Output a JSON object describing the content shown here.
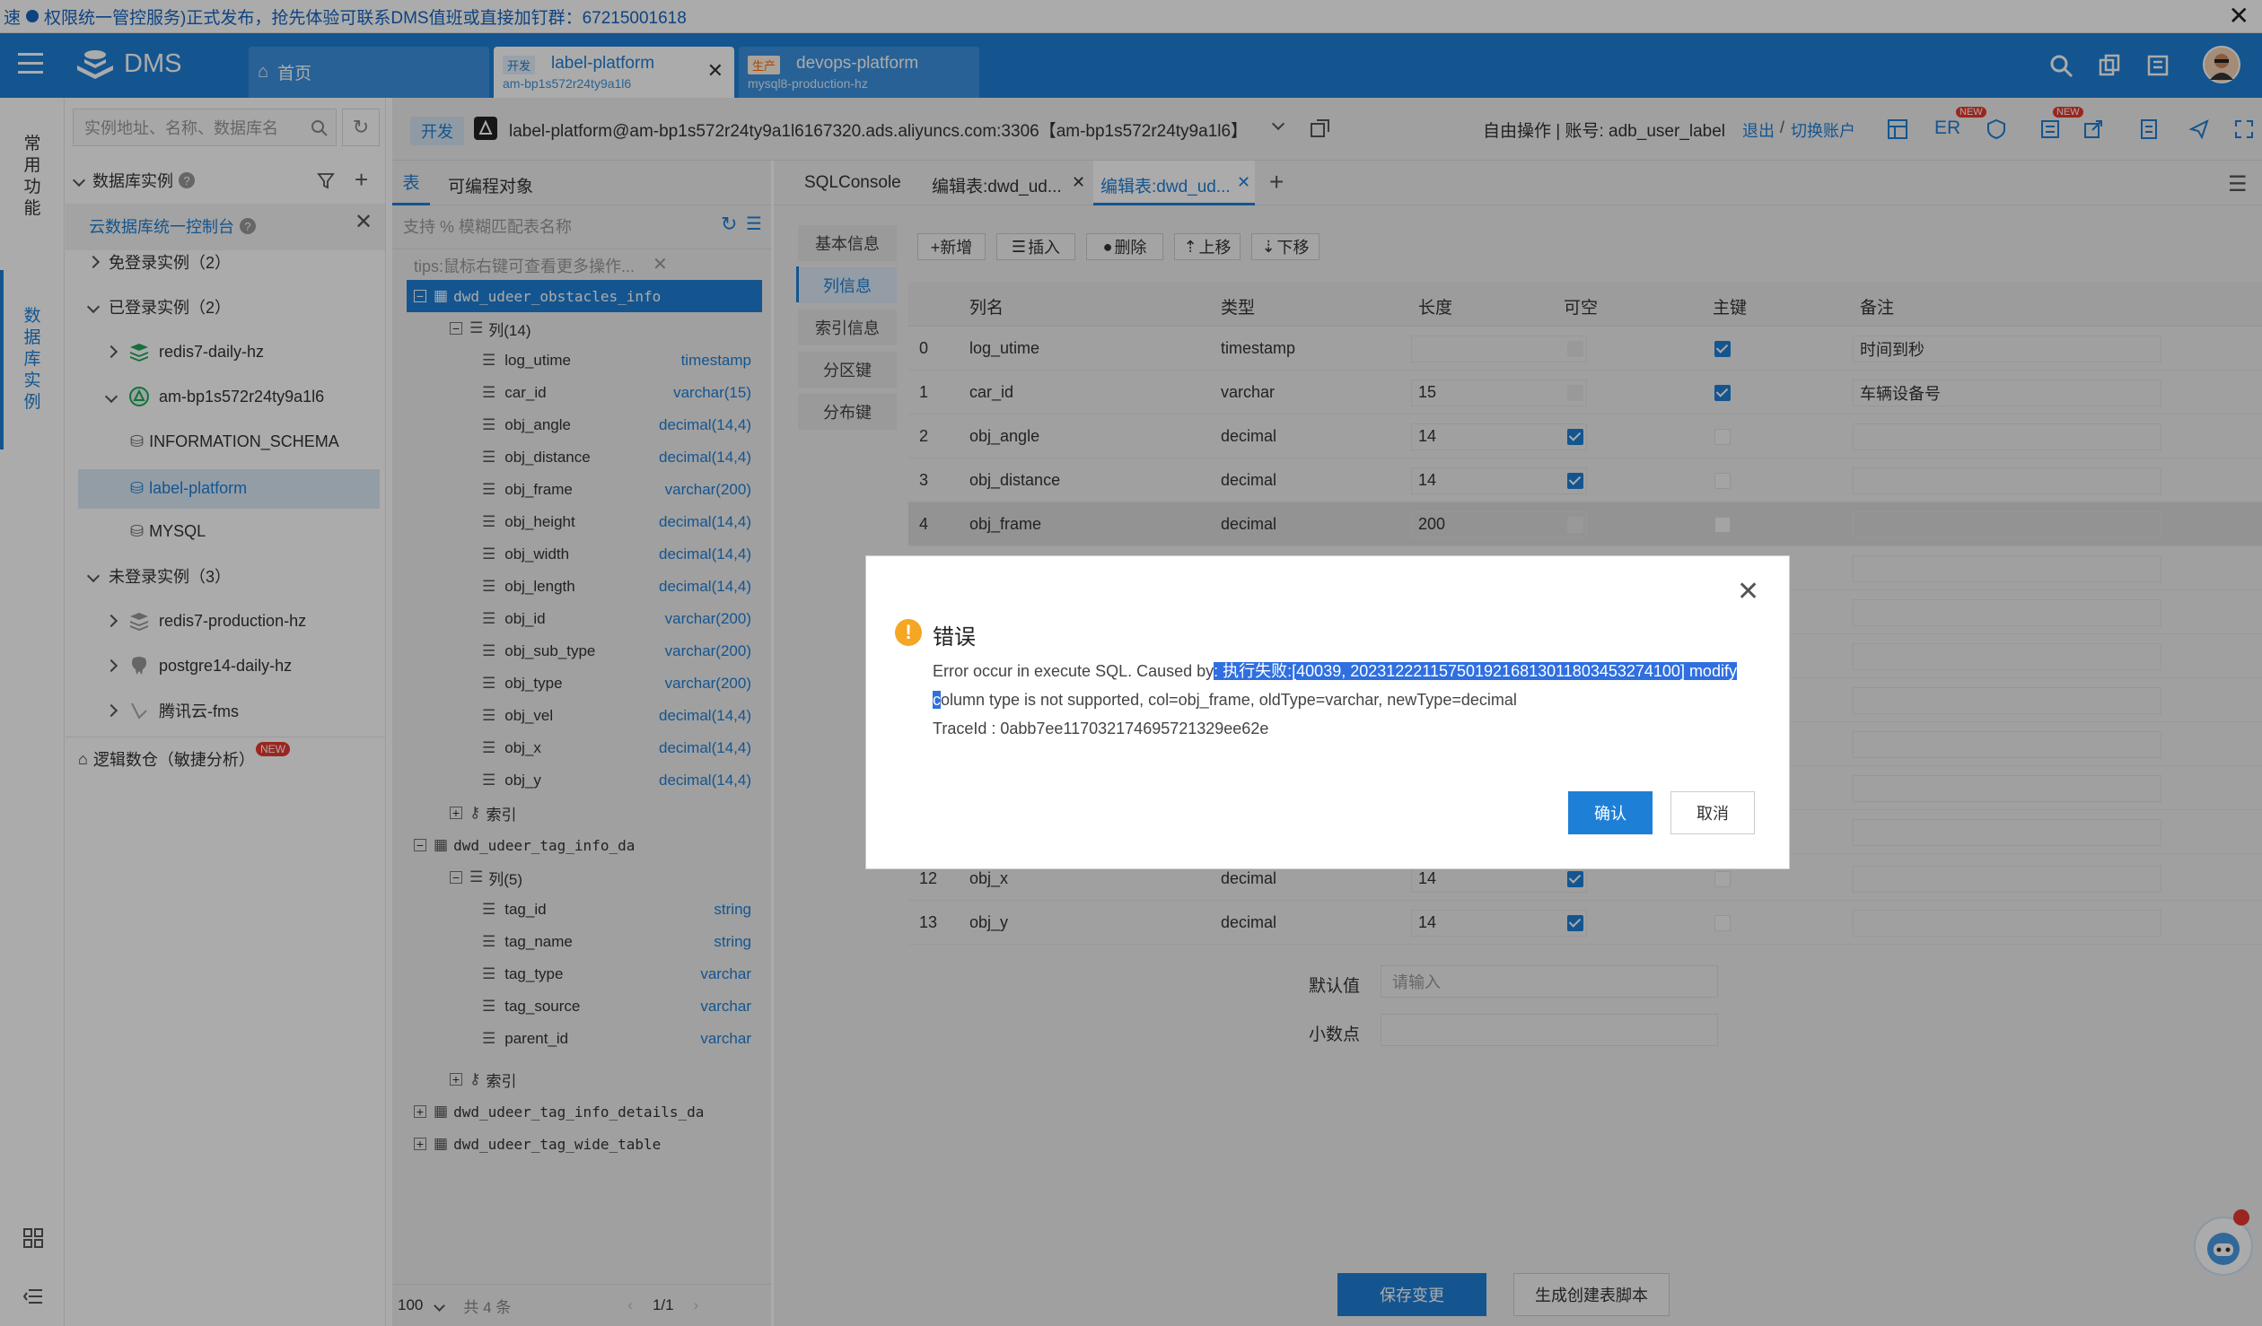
{
  "notice": {
    "text": "权限统一管控服务)正式发布，抢先体验可联系DMS值班或直接加钉群：67215001618",
    "prefix": "速"
  },
  "nav": {
    "app_name": "DMS",
    "tabs": [
      {
        "label": "首页"
      },
      {
        "env": "开发",
        "label": "label-platform",
        "sub": "am-bp1s572r24ty9a1l6",
        "env_color": "#1e7fd6"
      },
      {
        "env": "生产",
        "label": "devops-platform",
        "sub": "mysql8-production-hz",
        "env_color": "#ff6a00"
      }
    ]
  },
  "rail": {
    "common": "常用功能",
    "db_instance": "数据库实例"
  },
  "instances": {
    "search_placeholder": "实例地址、名称、数据库名",
    "header": "数据库实例",
    "console_link": "云数据库统一控制台",
    "groups": [
      {
        "label": "免登录实例（2）"
      },
      {
        "label": "已登录实例（2）"
      },
      {
        "label": "未登录实例（3）"
      }
    ],
    "logged_in": [
      {
        "label": "redis7-daily-hz"
      },
      {
        "label": "am-bp1s572r24ty9a1l6"
      }
    ],
    "databases": [
      "INFORMATION_SCHEMA",
      "label-platform",
      "MYSQL"
    ],
    "not_logged": [
      {
        "label": "redis7-production-hz"
      },
      {
        "label": "postgre14-daily-hz"
      },
      {
        "label": "腾讯云-fms"
      }
    ],
    "logic_db": "逻辑数仓（敏捷分析）",
    "new_badge": "NEW"
  },
  "connbar": {
    "env": "开发",
    "conn": "label-platform@am-bp1s572r24ty9a1l6167320.ads.aliyuncs.com:3306【am-bp1s572r24ty9a1l6】",
    "mode": "自由操作 | 账号: adb_user_label",
    "logout": "退出",
    "switch": "切换账户",
    "er": "ER",
    "new_badge": "NEW"
  },
  "objects": {
    "tab_table": "表",
    "tab_prog": "可编程对象",
    "search_placeholder": "支持 % 模糊匹配表名称",
    "tips": "tips:鼠标右键可查看更多操作...",
    "table1": "dwd_udeer_obstacles_info",
    "cols1_label": "列(14)",
    "cols1": [
      {
        "name": "log_utime",
        "type": "timestamp"
      },
      {
        "name": "car_id",
        "type": "varchar(15)"
      },
      {
        "name": "obj_angle",
        "type": "decimal(14,4)"
      },
      {
        "name": "obj_distance",
        "type": "decimal(14,4)"
      },
      {
        "name": "obj_frame",
        "type": "varchar(200)"
      },
      {
        "name": "obj_height",
        "type": "decimal(14,4)"
      },
      {
        "name": "obj_width",
        "type": "decimal(14,4)"
      },
      {
        "name": "obj_length",
        "type": "decimal(14,4)"
      },
      {
        "name": "obj_id",
        "type": "varchar(200)"
      },
      {
        "name": "obj_sub_type",
        "type": "varchar(200)"
      },
      {
        "name": "obj_type",
        "type": "varchar(200)"
      },
      {
        "name": "obj_vel",
        "type": "decimal(14,4)"
      },
      {
        "name": "obj_x",
        "type": "decimal(14,4)"
      },
      {
        "name": "obj_y",
        "type": "decimal(14,4)"
      }
    ],
    "index_label": "索引",
    "table2": "dwd_udeer_tag_info_da",
    "cols2_label": "列(5)",
    "cols2": [
      {
        "name": "tag_id",
        "type": "string"
      },
      {
        "name": "tag_name",
        "type": "string"
      },
      {
        "name": "tag_type",
        "type": "varchar"
      },
      {
        "name": "tag_source",
        "type": "varchar"
      },
      {
        "name": "parent_id",
        "type": "varchar"
      }
    ],
    "table3": "dwd_udeer_tag_info_details_da",
    "table4": "dwd_udeer_tag_wide_table",
    "page_size": "100",
    "total": "共 4 条",
    "page": "1/1"
  },
  "editor": {
    "tabs": [
      "SQLConsole",
      "编辑表:dwd_ud...",
      "编辑表:dwd_ud..."
    ],
    "side_tabs": [
      "基本信息",
      "列信息",
      "索引信息",
      "分区键",
      "分布键"
    ],
    "toolbar": [
      "+新增",
      "插入",
      "删除",
      "上移",
      "下移"
    ],
    "headers": [
      "列名",
      "类型",
      "长度",
      "可空",
      "主键",
      "备注"
    ],
    "rows": [
      {
        "idx": "0",
        "name": "log_utime",
        "type": "timestamp",
        "len": "",
        "nullable": "dis",
        "pk": "on",
        "remark": "时间到秒"
      },
      {
        "idx": "1",
        "name": "car_id",
        "type": "varchar",
        "len": "15",
        "nullable": "dis",
        "pk": "on",
        "remark": "车辆设备号"
      },
      {
        "idx": "2",
        "name": "obj_angle",
        "type": "decimal",
        "len": "14",
        "nullable": "on",
        "pk": "off",
        "remark": ""
      },
      {
        "idx": "3",
        "name": "obj_distance",
        "type": "decimal",
        "len": "14",
        "nullable": "on",
        "pk": "off",
        "remark": ""
      },
      {
        "idx": "4",
        "name": "obj_frame",
        "type": "decimal",
        "len": "200",
        "nullable": "dis",
        "pk": "off",
        "remark": ""
      },
      {
        "idx": "12",
        "name": "obj_x",
        "type": "decimal",
        "len": "14",
        "nullable": "on",
        "pk": "off",
        "remark": ""
      },
      {
        "idx": "13",
        "name": "obj_y",
        "type": "decimal",
        "len": "14",
        "nullable": "on",
        "pk": "off",
        "remark": ""
      }
    ],
    "default_label": "默认值",
    "default_placeholder": "请输入",
    "decimal_label": "小数点",
    "save_btn": "保存变更",
    "gen_btn": "生成创建表脚本"
  },
  "dialog": {
    "title": "错误",
    "msg_prefix": "Error occur in execute SQL. Caused by",
    "msg_highlight": ": 执行失败:[40039, 2023122211575019216813011803453274100] modify",
    "msg_line2_first": "c",
    "msg_line2_rest": "olumn type is not supported, col=obj_frame, oldType=varchar, newType=decimal",
    "trace": "TraceId : 0abb7ee117032174695721329ee62e",
    "ok": "确认",
    "cancel": "取消"
  },
  "colors": {
    "primary": "#1e7fd6",
    "warning": "#f5a623",
    "danger": "#e8382f"
  }
}
